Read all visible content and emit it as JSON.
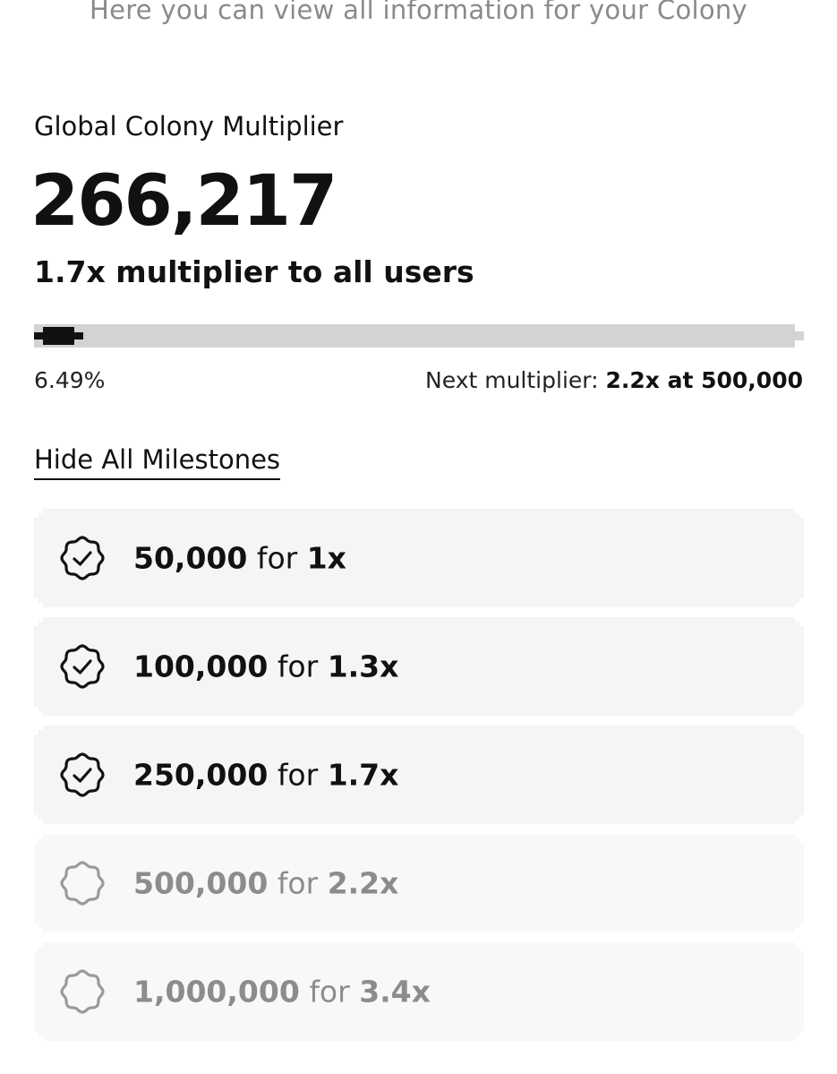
{
  "header": {
    "subtitle": "Here you can view all information for your Colony"
  },
  "summary": {
    "label": "Global Colony Multiplier",
    "total": "266,217",
    "current_multiplier_text": "1.7x multiplier to all users"
  },
  "progress": {
    "percent": 6.49,
    "percent_label": "6.49%",
    "next_label": "Next multiplier:",
    "next_value": "2.2x at 500,000"
  },
  "milestones_toggle": {
    "label": "Hide All Milestones"
  },
  "milestones": [
    {
      "amount": "50,000",
      "for": "for",
      "multiplier": "1x",
      "achieved": true,
      "icon": "check-badge-icon"
    },
    {
      "amount": "100,000",
      "for": "for",
      "multiplier": "1.3x",
      "achieved": true,
      "icon": "check-badge-icon"
    },
    {
      "amount": "250,000",
      "for": "for",
      "multiplier": "1.7x",
      "achieved": true,
      "icon": "check-badge-icon"
    },
    {
      "amount": "500,000",
      "for": "for",
      "multiplier": "2.2x",
      "achieved": false,
      "icon": "empty-badge-icon"
    },
    {
      "amount": "1,000,000",
      "for": "for",
      "multiplier": "3.4x",
      "achieved": false,
      "icon": "empty-badge-icon"
    }
  ],
  "colors": {
    "text": "#111111",
    "muted": "#8a8a8a",
    "track": "#d3d3d3",
    "card": "#f5f5f5",
    "locked_icon": "#9a9a9a"
  }
}
